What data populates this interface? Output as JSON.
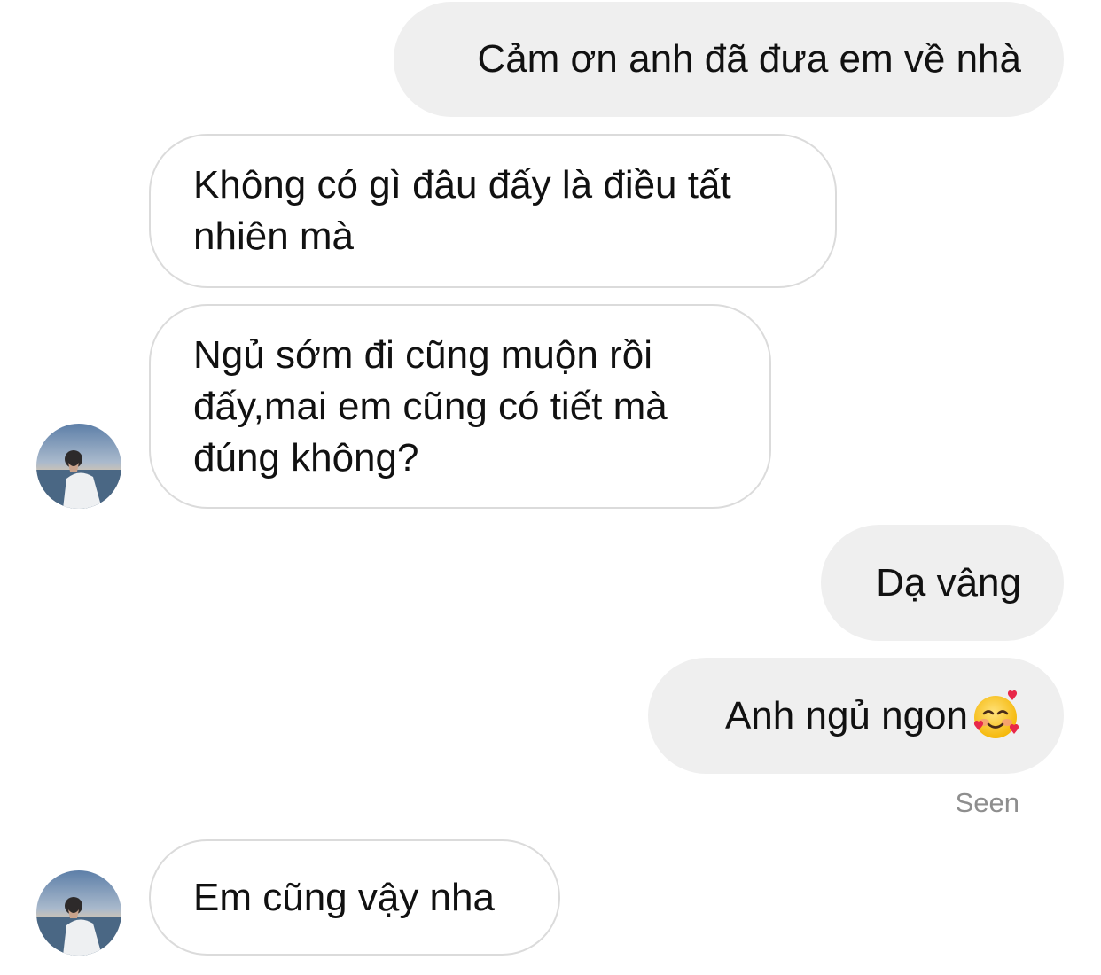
{
  "messages": [
    {
      "direction": "sent",
      "text": "Cảm ơn anh đã đưa em về nhà"
    },
    {
      "direction": "received",
      "text": "Không có gì đâu đấy là điều tất\nnhiên mà"
    },
    {
      "direction": "received",
      "text": "Ngủ sớm đi cũng muộn rồi\nđấy,mai em cũng có tiết mà\nđúng không?"
    },
    {
      "direction": "sent",
      "text": "Dạ vâng"
    },
    {
      "direction": "sent",
      "text": "Anh ngủ ngon",
      "emoji": "smiling-face-with-hearts-emoji"
    },
    {
      "direction": "received",
      "text": "Em cũng vậy nha"
    }
  ],
  "status": {
    "seen_label": "Seen"
  },
  "avatar": {
    "icon": "user-avatar-photo"
  },
  "colors": {
    "sent_bubble": "#efefef",
    "received_border": "#dbdbdb",
    "seen_text": "#8e8e8e"
  }
}
